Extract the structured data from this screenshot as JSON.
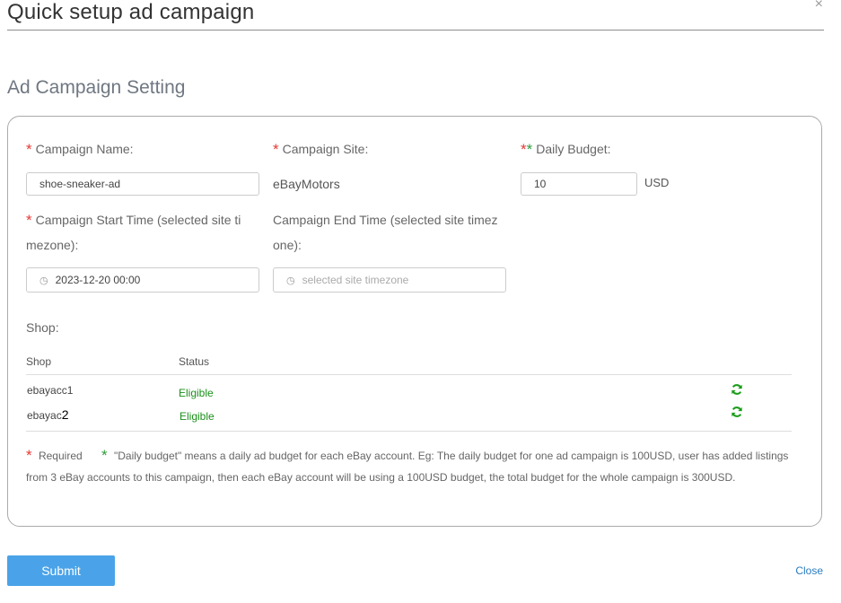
{
  "dialog": {
    "title": "Quick setup ad campaign",
    "close_icon": "×"
  },
  "section": {
    "title": "Ad Campaign Setting"
  },
  "form": {
    "campaign_name": {
      "required": "*",
      "label": "Campaign Name:",
      "value": "shoe-sneaker-ad"
    },
    "campaign_site": {
      "required": "*",
      "label": "Campaign Site:",
      "value": "eBayMotors"
    },
    "daily_budget": {
      "required_red": "*",
      "required_green": "*",
      "label": "Daily Budget:",
      "value": "10",
      "unit": "USD"
    },
    "start_time": {
      "required": "*",
      "label_line1": "Campaign Start Time (selected site ti",
      "label_line2": "mezone):",
      "value": "2023-12-20 00:00"
    },
    "end_time": {
      "label_line1": "Campaign End Time (selected site timez",
      "label_line2": "one):",
      "placeholder": "selected site timezone"
    }
  },
  "shop": {
    "label": "Shop:",
    "columns": [
      "Shop",
      "Status"
    ],
    "rows": [
      {
        "shop": "ebayacc1",
        "status": "Eligible"
      },
      {
        "shop": "ebayac",
        "shop_suffix": "2",
        "status": "Eligible"
      }
    ]
  },
  "note": {
    "required_mark": "*",
    "required_text": "Required",
    "green_mark": "*",
    "text": "\"Daily budget\" means a daily ad budget for each eBay account. Eg: The daily budget for one ad campaign is 100USD, user has added listings from 3 eBay accounts to this campaign, then each eBay account will be using a 100USD budget, the total budget for the whole campaign is 300USD."
  },
  "footer": {
    "submit": "Submit",
    "close": "Close"
  },
  "colors": {
    "accent": "#4aa3e8",
    "required": "#e53935",
    "success": "#1a8f1a",
    "link": "#2a7bbf"
  }
}
